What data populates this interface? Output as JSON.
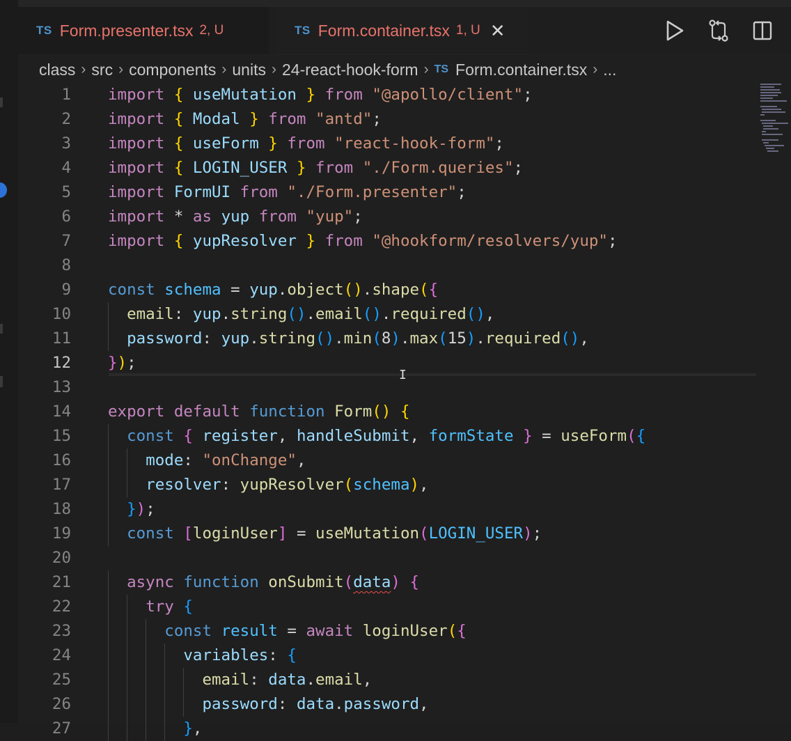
{
  "tabs": [
    {
      "icon": "TS",
      "name": "Form.presenter.tsx",
      "status": "2, U",
      "active": false
    },
    {
      "icon": "TS",
      "name": "Form.container.tsx",
      "status": "1, U",
      "active": true,
      "close": "✕"
    }
  ],
  "breadcrumb": {
    "parts": [
      "class",
      "src",
      "components",
      "units",
      "24-react-hook-form"
    ],
    "file_icon": "TS",
    "file": "Form.container.tsx",
    "tail": "...",
    "separator": "›"
  },
  "line_numbers": [
    "1",
    "2",
    "3",
    "4",
    "5",
    "6",
    "7",
    "8",
    "9",
    "10",
    "11",
    "12",
    "13",
    "14",
    "15",
    "16",
    "17",
    "18",
    "19",
    "20",
    "21",
    "22",
    "23",
    "24",
    "25",
    "26",
    "27"
  ],
  "code_lines": [
    "import { useMutation } from \"@apollo/client\";",
    "import { Modal } from \"antd\";",
    "import { useForm } from \"react-hook-form\";",
    "import { LOGIN_USER } from \"./Form.queries\";",
    "import FormUI from \"./Form.presenter\";",
    "import * as yup from \"yup\";",
    "import { yupResolver } from \"@hookform/resolvers/yup\";",
    "",
    "const schema = yup.object().shape({",
    "  email: yup.string().email().required(),",
    "  password: yup.string().min(8).max(15).required(),",
    "});",
    "",
    "export default function Form() {",
    "  const { register, handleSubmit, formState } = useForm({",
    "    mode: \"onChange\",",
    "    resolver: yupResolver(schema),",
    "  });",
    "  const [loginUser] = useMutation(LOGIN_USER);",
    "",
    "  async function onSubmit(data) {",
    "    try {",
    "      const result = await loginUser({",
    "        variables: {",
    "          email: data.email,",
    "          password: data.password,",
    "        },"
  ],
  "active_line": 12,
  "icons": {
    "run": "play-icon",
    "compare": "source-compare-icon",
    "split": "split-editor-icon"
  },
  "colors": {
    "background": "#1e1e1e",
    "modified_file": "#e8736b",
    "ts_icon": "#4e94ce",
    "keyword": "#c586c0",
    "string": "#ce9178",
    "variable": "#9cdcfe",
    "function": "#dcdcaa"
  }
}
